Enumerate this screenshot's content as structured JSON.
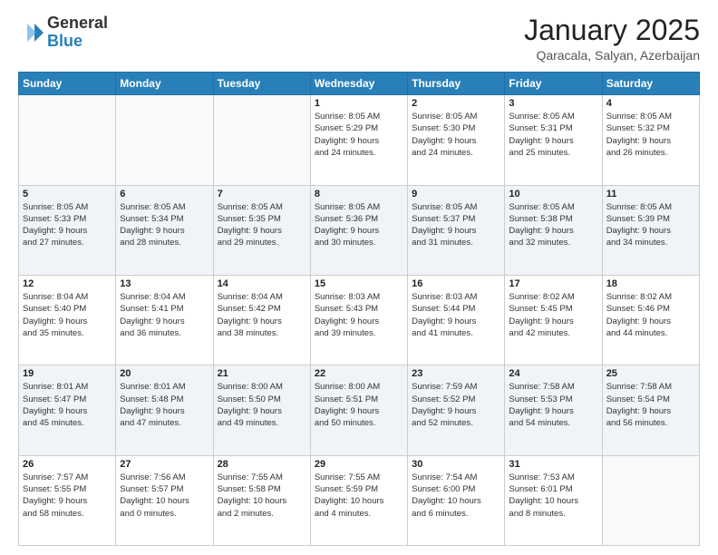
{
  "header": {
    "logo": {
      "general": "General",
      "blue": "Blue"
    },
    "title": "January 2025",
    "location": "Qaracala, Salyan, Azerbaijan"
  },
  "weekdays": [
    "Sunday",
    "Monday",
    "Tuesday",
    "Wednesday",
    "Thursday",
    "Friday",
    "Saturday"
  ],
  "weeks": [
    [
      {
        "day": "",
        "info": ""
      },
      {
        "day": "",
        "info": ""
      },
      {
        "day": "",
        "info": ""
      },
      {
        "day": "1",
        "info": "Sunrise: 8:05 AM\nSunset: 5:29 PM\nDaylight: 9 hours\nand 24 minutes."
      },
      {
        "day": "2",
        "info": "Sunrise: 8:05 AM\nSunset: 5:30 PM\nDaylight: 9 hours\nand 24 minutes."
      },
      {
        "day": "3",
        "info": "Sunrise: 8:05 AM\nSunset: 5:31 PM\nDaylight: 9 hours\nand 25 minutes."
      },
      {
        "day": "4",
        "info": "Sunrise: 8:05 AM\nSunset: 5:32 PM\nDaylight: 9 hours\nand 26 minutes."
      }
    ],
    [
      {
        "day": "5",
        "info": "Sunrise: 8:05 AM\nSunset: 5:33 PM\nDaylight: 9 hours\nand 27 minutes."
      },
      {
        "day": "6",
        "info": "Sunrise: 8:05 AM\nSunset: 5:34 PM\nDaylight: 9 hours\nand 28 minutes."
      },
      {
        "day": "7",
        "info": "Sunrise: 8:05 AM\nSunset: 5:35 PM\nDaylight: 9 hours\nand 29 minutes."
      },
      {
        "day": "8",
        "info": "Sunrise: 8:05 AM\nSunset: 5:36 PM\nDaylight: 9 hours\nand 30 minutes."
      },
      {
        "day": "9",
        "info": "Sunrise: 8:05 AM\nSunset: 5:37 PM\nDaylight: 9 hours\nand 31 minutes."
      },
      {
        "day": "10",
        "info": "Sunrise: 8:05 AM\nSunset: 5:38 PM\nDaylight: 9 hours\nand 32 minutes."
      },
      {
        "day": "11",
        "info": "Sunrise: 8:05 AM\nSunset: 5:39 PM\nDaylight: 9 hours\nand 34 minutes."
      }
    ],
    [
      {
        "day": "12",
        "info": "Sunrise: 8:04 AM\nSunset: 5:40 PM\nDaylight: 9 hours\nand 35 minutes."
      },
      {
        "day": "13",
        "info": "Sunrise: 8:04 AM\nSunset: 5:41 PM\nDaylight: 9 hours\nand 36 minutes."
      },
      {
        "day": "14",
        "info": "Sunrise: 8:04 AM\nSunset: 5:42 PM\nDaylight: 9 hours\nand 38 minutes."
      },
      {
        "day": "15",
        "info": "Sunrise: 8:03 AM\nSunset: 5:43 PM\nDaylight: 9 hours\nand 39 minutes."
      },
      {
        "day": "16",
        "info": "Sunrise: 8:03 AM\nSunset: 5:44 PM\nDaylight: 9 hours\nand 41 minutes."
      },
      {
        "day": "17",
        "info": "Sunrise: 8:02 AM\nSunset: 5:45 PM\nDaylight: 9 hours\nand 42 minutes."
      },
      {
        "day": "18",
        "info": "Sunrise: 8:02 AM\nSunset: 5:46 PM\nDaylight: 9 hours\nand 44 minutes."
      }
    ],
    [
      {
        "day": "19",
        "info": "Sunrise: 8:01 AM\nSunset: 5:47 PM\nDaylight: 9 hours\nand 45 minutes."
      },
      {
        "day": "20",
        "info": "Sunrise: 8:01 AM\nSunset: 5:48 PM\nDaylight: 9 hours\nand 47 minutes."
      },
      {
        "day": "21",
        "info": "Sunrise: 8:00 AM\nSunset: 5:50 PM\nDaylight: 9 hours\nand 49 minutes."
      },
      {
        "day": "22",
        "info": "Sunrise: 8:00 AM\nSunset: 5:51 PM\nDaylight: 9 hours\nand 50 minutes."
      },
      {
        "day": "23",
        "info": "Sunrise: 7:59 AM\nSunset: 5:52 PM\nDaylight: 9 hours\nand 52 minutes."
      },
      {
        "day": "24",
        "info": "Sunrise: 7:58 AM\nSunset: 5:53 PM\nDaylight: 9 hours\nand 54 minutes."
      },
      {
        "day": "25",
        "info": "Sunrise: 7:58 AM\nSunset: 5:54 PM\nDaylight: 9 hours\nand 56 minutes."
      }
    ],
    [
      {
        "day": "26",
        "info": "Sunrise: 7:57 AM\nSunset: 5:55 PM\nDaylight: 9 hours\nand 58 minutes."
      },
      {
        "day": "27",
        "info": "Sunrise: 7:56 AM\nSunset: 5:57 PM\nDaylight: 10 hours\nand 0 minutes."
      },
      {
        "day": "28",
        "info": "Sunrise: 7:55 AM\nSunset: 5:58 PM\nDaylight: 10 hours\nand 2 minutes."
      },
      {
        "day": "29",
        "info": "Sunrise: 7:55 AM\nSunset: 5:59 PM\nDaylight: 10 hours\nand 4 minutes."
      },
      {
        "day": "30",
        "info": "Sunrise: 7:54 AM\nSunset: 6:00 PM\nDaylight: 10 hours\nand 6 minutes."
      },
      {
        "day": "31",
        "info": "Sunrise: 7:53 AM\nSunset: 6:01 PM\nDaylight: 10 hours\nand 8 minutes."
      },
      {
        "day": "",
        "info": ""
      }
    ]
  ]
}
